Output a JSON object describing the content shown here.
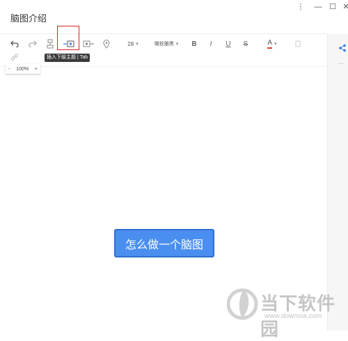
{
  "window": {
    "title": "脑图介绍"
  },
  "titlebar_controls": {
    "more": "⋮",
    "minimize": "—",
    "maximize": "☐",
    "close": "✕"
  },
  "toolbar": {
    "font_size": "28",
    "font_family": "微软雅黑",
    "bold": "B",
    "italic": "I",
    "underline": "U",
    "strike": "S",
    "font_color_label": "A",
    "font_color": "#e03a2a"
  },
  "tooltip": {
    "text": "插入下级主题 | Tab"
  },
  "zoom": {
    "minus": "-",
    "value": "100%",
    "plus": "+"
  },
  "canvas": {
    "central_topic": "怎么做一个脑图"
  },
  "right_panel": {
    "more": "···"
  },
  "watermark": {
    "text": "当下软件园",
    "url": "www.downxia.com"
  },
  "colors": {
    "highlight": "#e01e1e",
    "node_fill": "#4a8ff0",
    "node_border": "#2f6fd0"
  }
}
